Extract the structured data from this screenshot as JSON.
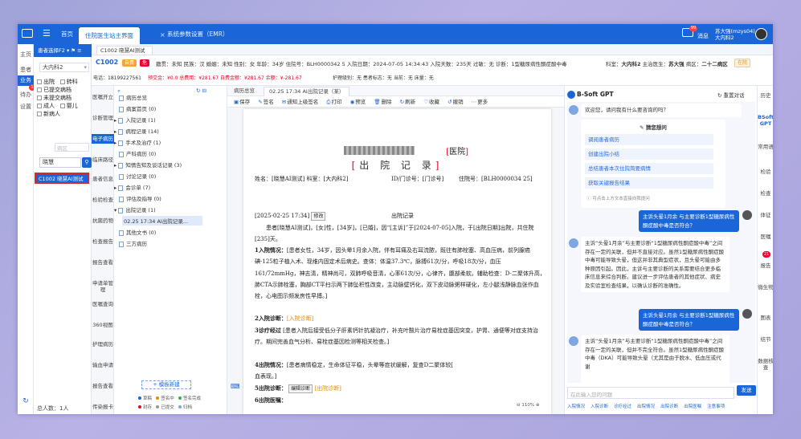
{
  "topbar": {
    "menu_icon": "menu-icon",
    "tabs": [
      "首页",
      "住院医生站主界面",
      "系统参数设置（EMR）"
    ],
    "messages_count": "99",
    "messages": "消息",
    "user_name": "苏大强(mzys04)",
    "dept": "大内科2"
  },
  "leftnav": [
    "主页",
    "患者",
    "业务",
    "待办",
    "设置"
  ],
  "leftnav_badge": "1",
  "patient_list": {
    "selector": "患者选择F2",
    "dept": "大内科2",
    "checkboxes": [
      [
        "出院",
        "转科"
      ],
      [
        "已提交病档"
      ],
      [
        "未提交病档"
      ],
      [
        "成人",
        "婴儿"
      ],
      [
        "新病人"
      ]
    ],
    "ward_placeholder": "病区",
    "search_value": "晓慧",
    "current": "C1002  晓慧AI测试",
    "total": "总人数：1人"
  },
  "patient_tab": "C1002 晓慧AI测试",
  "patient": {
    "id": "C1002",
    "tags": [
      "自费",
      "危"
    ],
    "info": "籍贯：未知  民族：汉  婚姻：未知  性别：女  年龄：34岁  住院号：BLH0000342 5  入院日期：2024-07-05 14:34:43  入院天数：235天  过敏：无  诊断：1型糖尿病性酮症酸中毒",
    "dept": "科室：",
    "dept_val": "大内科2",
    "doctor": "主治医生：",
    "doctor_val": "苏大强",
    "ward": "病区：",
    "ward_val": "二十二病区",
    "status": "在院",
    "phone": "电话：18199227561",
    "fees": "预交金：¥0.0   总费用：¥281.67   自费金额：¥281.67   余额：¥-281.67",
    "nursing": "护理级别：无   患者标志：无   当前：无   床量：无"
  },
  "doc_left": [
    "医嘱开立",
    "诊断管理",
    "电子病历",
    "临床路径",
    "患者信息",
    "检验检查",
    "抗菌药物",
    "检查报告",
    "报告查看",
    "申请单管理",
    "医嘱查询",
    "360视图",
    "护理病历",
    "输血申请",
    "报告查看",
    "传染报卡",
    "更多"
  ],
  "tree": {
    "items": [
      "病历总览",
      "病案首页 (0)",
      "入院记录 (1)",
      "病程记录 (14)",
      "手术及治疗 (1)",
      "产科病历 (0)",
      "知情告知及谈话记录 (3)",
      "讨论记录 (0)",
      "会诊单 (7)",
      "评估及指导 (0)",
      "出院记录 (1)",
      "02.25 17:34 AI出院记录...",
      "其他文书 (0)",
      "三方病历"
    ],
    "add": "+ 模板新建",
    "legend": [
      "草稿",
      "签名中",
      "签名完成",
      "封存",
      "已提交",
      "归档"
    ]
  },
  "doc": {
    "tabs": [
      "病历总览",
      "02.25 17:34 AI出院记录（某）"
    ],
    "toolbar": [
      "保存",
      "签名",
      "通知上级签名",
      "打印",
      "预览",
      "删除",
      "刷新",
      "收藏",
      "撤销",
      "更多"
    ],
    "hospital": "医院",
    "title": "出 院 记 录",
    "name_line": "姓名：[晓慧AI测试]  科室：[大内科2]",
    "id_line": "ID/门诊号：[门诊号]",
    "inp_line": "住院号：[BLH0000034 25]",
    "date": "[2025-02-25 17:34]",
    "modify": "修改",
    "head": "出院记录",
    "para1": "患者[晓慧AI测试]，[女]性，[34岁]，[已婚]，因“[主诉]”于[2024-07-05]入院，于[出院日期]出院，共住院[235]天。",
    "s1": "1入院情况：",
    "s1t": "[患者女性，34岁，因头晕1月余入院，伴有耳痛及右耳流脓，既往有肺栓塞、高血压病，前列腺癌碘-125粒子植入术、现维内固定术后病史。查体：体温37.3℃，脉搏61次/分，呼吸18次/分，血压161/72mmHg，神志清，精神尚可，双肺呼吸音清，心率61次/分，心律齐，腹部柔软。辅助检查：D-二聚体升高，肺CTA示肺栓塞，胸部CT平扫示两下肺坠积性改变，主动脉壁钙化，双下皮动脉粥样硬化，左小腿浅静脉血张作血栓，心电图示频发房性早搏。]",
    "s2": "2入院诊断：",
    "s2t": "[入院诊断]",
    "s3": "3诊疗经过",
    "s3t": "[患者入院后接受低分子肝素钙针抗凝治疗，补充叶酸片治疗易栓症基因突变，护胃、通便等对症支持治疗。期间完善血气分析、易栓症基因检测等相关检查。]",
    "s4": "4出院情况：",
    "s4t": "[患者病情稳定，生命体征平稳，头晕等症状缓解，复查D二聚体较[",
    "s4b": "血表现。]",
    "s5": "5出院诊断：",
    "s5btn": "编辑诊断",
    "s5t": "[出院诊断]",
    "s6": "6出院医嘱：",
    "zoom": "110%"
  },
  "gpt": {
    "title": "B-Soft GPT",
    "reset": "重置对话",
    "welcome": "欢迎您，请问我有什么要咨询的吗？",
    "guess": "猜您想问",
    "suggestions": [
      "调阅患者病历",
      "创建出院小结",
      "总结患者本次住院简要病情",
      "获取关键报告结果"
    ],
    "tip": "可点击上方文本直接向我提问",
    "q1": "主诉头晕1月余 与主要诊断1型糖尿病性酮症酸中毒是否符合？",
    "a1": "主诉“头晕1月余”与主要诊断“1型糖尿病性酮症酸中毒”之间存在一定的关联，但并不直接对应。虽然1型糖尿病性酮症酸中毒可能导致头晕，但这并非其典型症状，且头晕可能由多种原因引起。因此，主诉与主要诊断的关系需要结合更多临床信息来综合判断。建议进一步评估患者的其他症状、病史及实验室检查结果，以确认诊断的准确性。",
    "q2": "主诉头晕1月余 与主要诊断1型糖尿病性酮症酸中毒是否符合？",
    "a2": "主诉“头晕1月余”与主要诊断“1型糖尿病性酮症酸中毒”之间存在一定的关联，但并不完全符合。虽然1型糖尿病性酮症酸中毒（DKA）可能导致头晕（尤其是由于脱水、低血压或代谢",
    "input_placeholder": "在此输入您的问题",
    "send": "发送",
    "quick": [
      "入院情况",
      "入院诊断",
      "诊疗经过",
      "出院情况",
      "出院诊断",
      "出院医嘱",
      "注意事项"
    ]
  },
  "rside": [
    "历史",
    "BSoft GPT",
    "常用语",
    "检验",
    "检查",
    "体征",
    "医嘱",
    "21",
    "报告",
    "微生物",
    "图表",
    "结节",
    "数据核查"
  ]
}
